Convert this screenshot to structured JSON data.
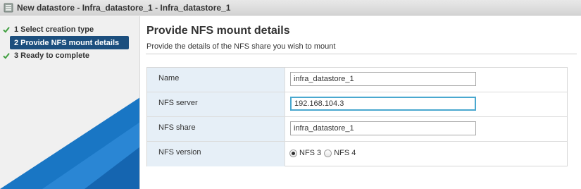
{
  "window": {
    "title": "New datastore - Infra_datastore_1 - Infra_datastore_1"
  },
  "steps": [
    {
      "label": "1 Select creation type",
      "state": "complete"
    },
    {
      "label": "2 Provide NFS mount details",
      "state": "active"
    },
    {
      "label": "3 Ready to complete",
      "state": "complete"
    }
  ],
  "page": {
    "heading": "Provide NFS mount details",
    "subtitle": "Provide the details of the NFS share you wish to mount"
  },
  "form": {
    "name": {
      "label": "Name",
      "value": "infra_datastore_1"
    },
    "nfs_server": {
      "label": "NFS server",
      "value": "192.168.104.3"
    },
    "nfs_share": {
      "label": "NFS share",
      "value": "infra_datastore_1"
    },
    "nfs_version": {
      "label": "NFS version",
      "options": [
        "NFS 3",
        "NFS 4"
      ],
      "selected": "NFS 3"
    }
  },
  "colors": {
    "active_step": "#1c4f7e",
    "check": "#3f9f3f",
    "label_bg": "#e6eff7",
    "focus_ring": "#4aa8cf",
    "decor_blue": "#1976c4"
  }
}
